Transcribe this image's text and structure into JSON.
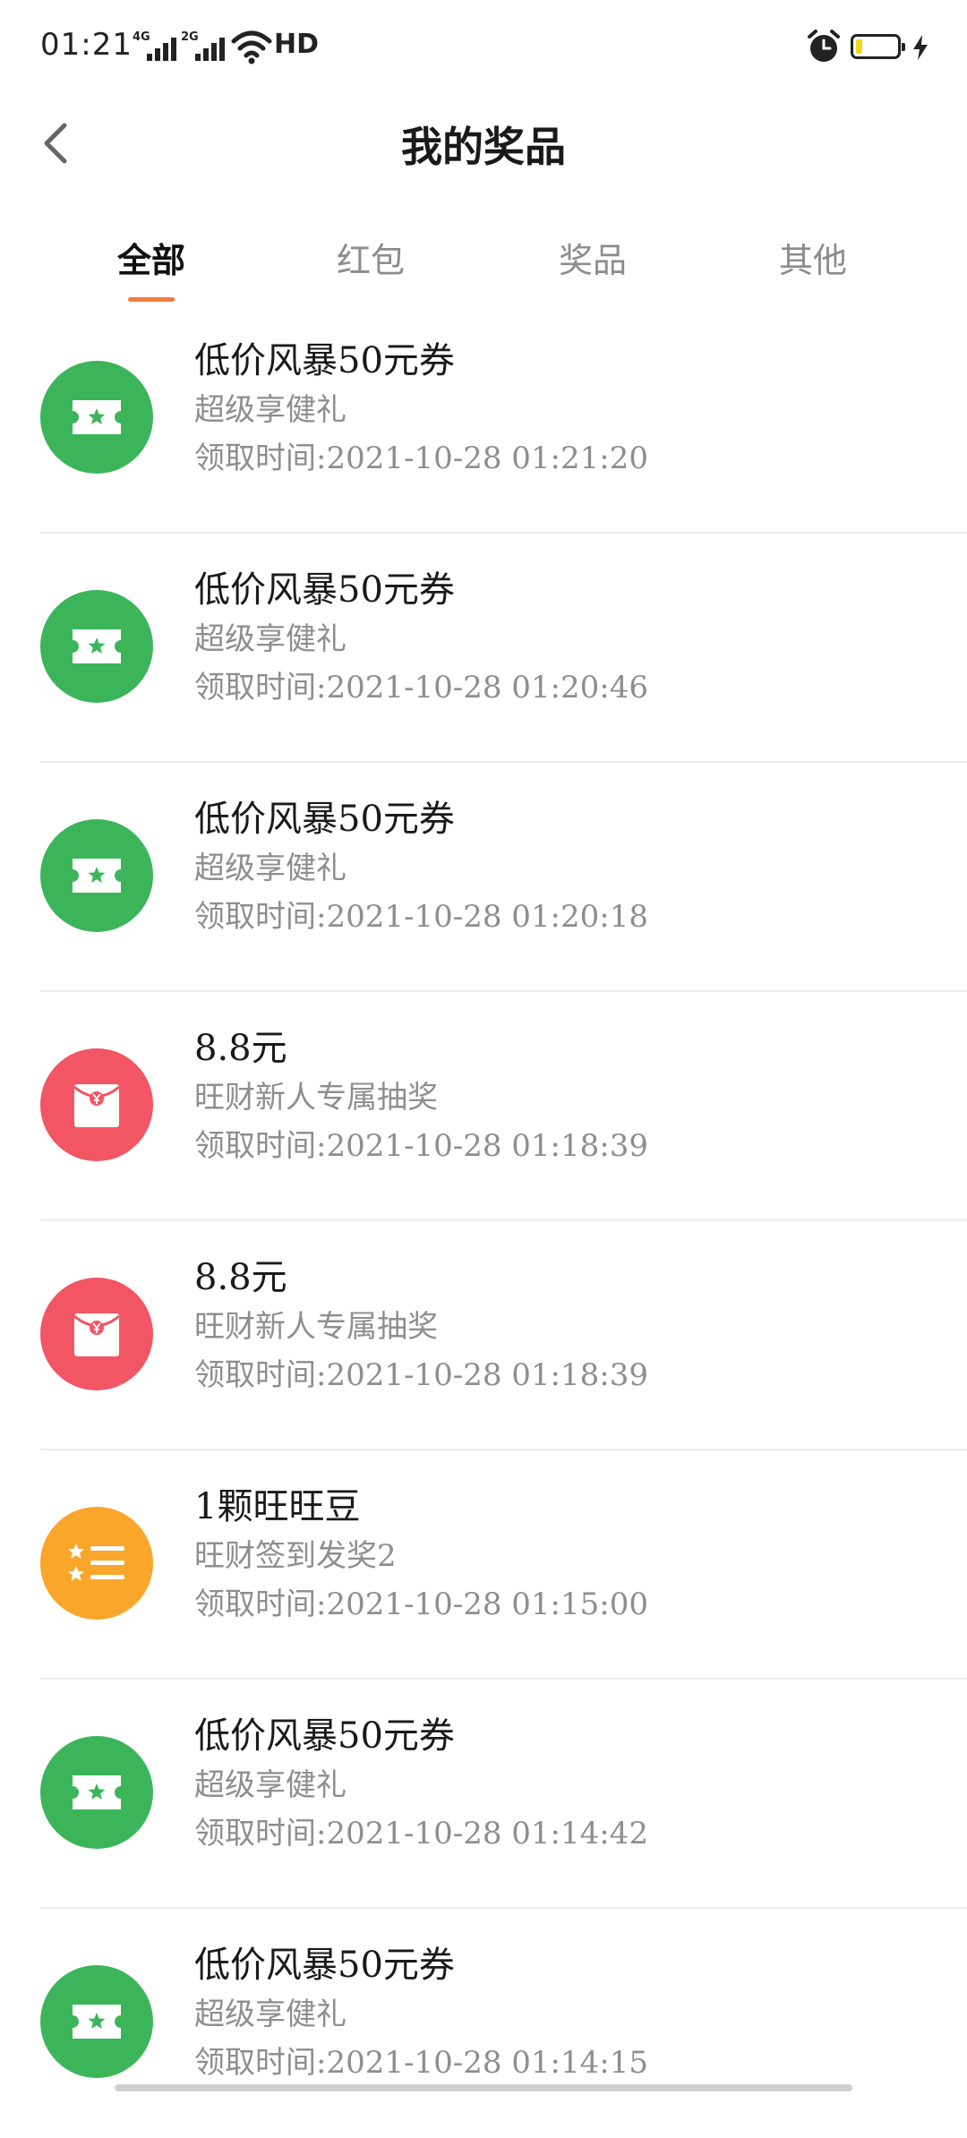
{
  "status_bar": {
    "time": "01:21",
    "signal_1_tag": "4G",
    "signal_2_tag": "2G",
    "hd_label": "HD",
    "icons": [
      "wifi-icon",
      "alarm-icon",
      "battery-icon",
      "charging-icon"
    ],
    "battery_level": 0.15
  },
  "header": {
    "title": "我的奖品",
    "back_icon": "chevron-left-icon"
  },
  "tabs": [
    {
      "label": "全部",
      "active": true
    },
    {
      "label": "红包",
      "active": false
    },
    {
      "label": "奖品",
      "active": false
    },
    {
      "label": "其他",
      "active": false
    }
  ],
  "colors": {
    "accent": "#ef7d3a",
    "coupon_green": "#3cb55a",
    "redpacket_red": "#f25563",
    "beans_orange": "#f9a62b"
  },
  "items": [
    {
      "icon": "coupon-ticket-icon",
      "title": "低价风暴50元券",
      "subtitle": "超级享健礼",
      "time": "领取时间:2021-10-28 01:21:20"
    },
    {
      "icon": "coupon-ticket-icon",
      "title": "低价风暴50元券",
      "subtitle": "超级享健礼",
      "time": "领取时间:2021-10-28 01:20:46"
    },
    {
      "icon": "coupon-ticket-icon",
      "title": "低价风暴50元券",
      "subtitle": "超级享健礼",
      "time": "领取时间:2021-10-28 01:20:18"
    },
    {
      "icon": "red-envelope-icon",
      "title": "8.8元",
      "subtitle": "旺财新人专属抽奖",
      "time": "领取时间:2021-10-28 01:18:39"
    },
    {
      "icon": "red-envelope-icon",
      "title": "8.8元",
      "subtitle": "旺财新人专属抽奖",
      "time": "领取时间:2021-10-28 01:18:39"
    },
    {
      "icon": "star-list-icon",
      "title": "1颗旺旺豆",
      "subtitle": "旺财签到发奖2",
      "time": "领取时间:2021-10-28 01:15:00"
    },
    {
      "icon": "coupon-ticket-icon",
      "title": "低价风暴50元券",
      "subtitle": "超级享健礼",
      "time": "领取时间:2021-10-28 01:14:42"
    },
    {
      "icon": "coupon-ticket-icon",
      "title": "低价风暴50元券",
      "subtitle": "超级享健礼",
      "time": "领取时间:2021-10-28 01:14:15"
    }
  ]
}
